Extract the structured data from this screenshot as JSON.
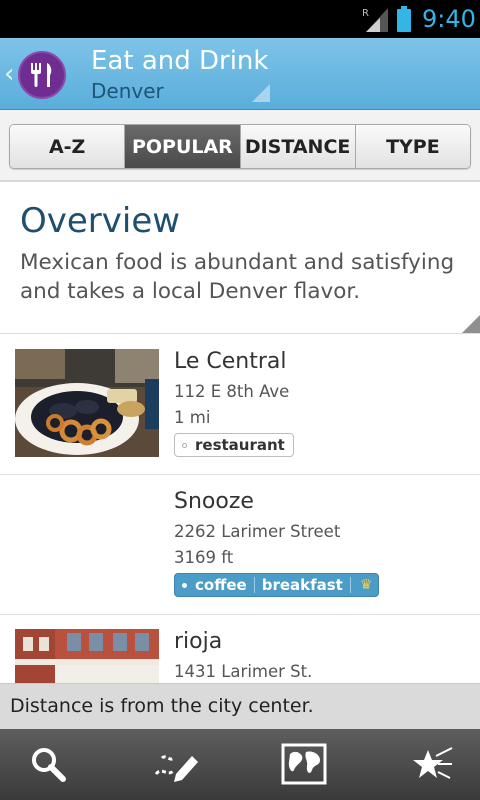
{
  "status_bar": {
    "time": "9:40",
    "roaming_indicator": "R",
    "icons": [
      "signal-icon",
      "battery-icon"
    ],
    "accent_color": "#33b5e5"
  },
  "action_bar": {
    "title": "Eat and Drink",
    "subtitle": "Denver",
    "app_icon": "fork-knife-icon",
    "brand_color": "#6f2c91",
    "bar_color": "#5aaedb"
  },
  "tabs": [
    {
      "label": "A-Z",
      "active": false
    },
    {
      "label": "POPULAR",
      "active": true
    },
    {
      "label": "DISTANCE",
      "active": false
    },
    {
      "label": "TYPE",
      "active": false
    }
  ],
  "overview": {
    "heading": "Overview",
    "body": "Mexican food is abundant and satisfying and takes a local Denver flavor."
  },
  "places": [
    {
      "name": "Le Central",
      "address": "112 E 8th Ave",
      "distance": "1 mi",
      "tags": [
        "restaurant"
      ],
      "featured": false,
      "thumbnail": "food-plate-photo"
    },
    {
      "name": "Snooze",
      "address": "2262 Larimer Street",
      "distance": "3169 ft",
      "tags": [
        "coffee",
        "breakfast"
      ],
      "featured": true,
      "thumbnail": null
    },
    {
      "name": "rioja",
      "address": "1431 Larimer St.",
      "distance": "",
      "tags": [],
      "featured": false,
      "thumbnail": "street-building-photo"
    }
  ],
  "info_bar": {
    "text": "Distance is from the city center."
  },
  "bottom_nav": {
    "items": [
      "search-icon",
      "pencil-note-icon",
      "map-icon",
      "favorites-star-icon"
    ]
  }
}
